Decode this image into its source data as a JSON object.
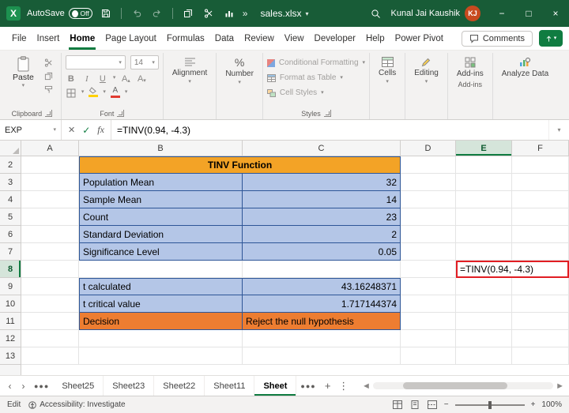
{
  "title_bar": {
    "autosave_label": "AutoSave",
    "autosave_state": "Off",
    "file_name": "sales.xlsx",
    "user_name": "Kunal Jai Kaushik",
    "user_initials": "KJ"
  },
  "menu": {
    "items": [
      "File",
      "Insert",
      "Home",
      "Page Layout",
      "Formulas",
      "Data",
      "Review",
      "View",
      "Developer",
      "Help",
      "Power Pivot"
    ],
    "comments_label": "Comments"
  },
  "ribbon": {
    "paste_label": "Paste",
    "font_size": "14",
    "bold": "B",
    "italic": "I",
    "underline": "U",
    "alignment_label": "Alignment",
    "number_label": "Number",
    "styles": [
      "Conditional Formatting",
      "Format as Table",
      "Cell Styles"
    ],
    "cells_label": "Cells",
    "editing_label": "Editing",
    "addins_label": "Add-ins",
    "analyze_label": "Analyze Data",
    "group_labels": {
      "clipboard": "Clipboard",
      "font": "Font",
      "styles": "Styles",
      "addins": "Add-ins"
    }
  },
  "formula_bar": {
    "name_box": "EXP",
    "formula": "=TINV(0.94, -4.3)"
  },
  "grid": {
    "columns": [
      "A",
      "B",
      "C",
      "D",
      "E",
      "F"
    ],
    "rows": [
      "2",
      "3",
      "4",
      "5",
      "6",
      "7",
      "8",
      "9",
      "10",
      "11",
      "12",
      "13"
    ],
    "title": "TINV Function",
    "data_rows": [
      {
        "label": "Population Mean",
        "value": "32"
      },
      {
        "label": "Sample Mean",
        "value": "14"
      },
      {
        "label": "Count",
        "value": "23"
      },
      {
        "label": "Standard Deviation",
        "value": "2"
      },
      {
        "label": "Significance Level",
        "value": "0.05"
      }
    ],
    "active_cell_text": "=TINV(0.94, -4.3)",
    "result_rows": [
      {
        "label": "t calculated",
        "value": "43.16248371"
      },
      {
        "label": "t critical value",
        "value": "1.717144374"
      }
    ],
    "decision": {
      "label": "Decision",
      "value": "Reject the null hypothesis"
    }
  },
  "sheet_tabs": {
    "tabs": [
      "Sheet25",
      "Sheet23",
      "Sheet22",
      "Sheet11",
      "Sheet"
    ]
  },
  "status_bar": {
    "mode": "Edit",
    "accessibility": "Accessibility: Investigate",
    "zoom": "100%"
  }
}
